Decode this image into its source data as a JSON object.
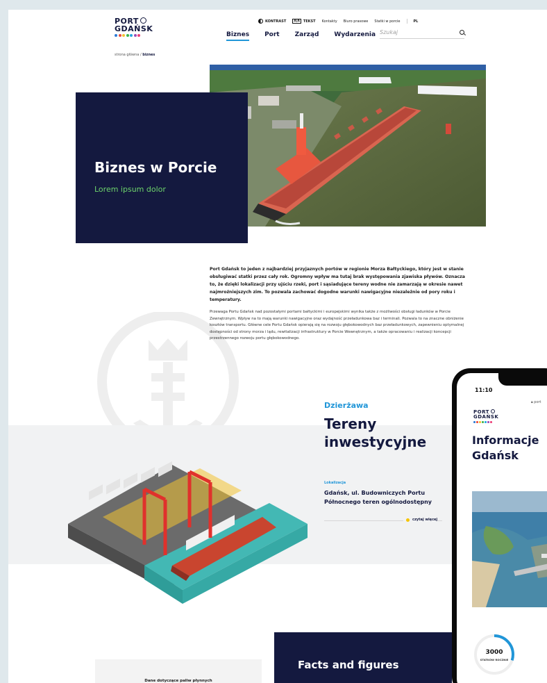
{
  "logo": {
    "line1": "PORT",
    "line2": "GDAŃSK",
    "dots": [
      "#2e7bd6",
      "#e94c3d",
      "#f6c12f",
      "#3cb24b",
      "#25a6e0",
      "#9b4fb8",
      "#ec407a"
    ]
  },
  "topbar": {
    "contrast": "KONTRAST",
    "aa": "A|A",
    "text_size": "TEKST",
    "links": [
      "Kontakty",
      "Biuro prasowe",
      "Statki w porcie"
    ],
    "lang": "PL"
  },
  "nav": {
    "items": [
      "Biznes",
      "Port",
      "Zarząd",
      "Wydarzenia"
    ],
    "active": "Biznes"
  },
  "search": {
    "placeholder": "Szukaj"
  },
  "breadcrumb": {
    "home": "strona główna",
    "sep": "/",
    "current": "biznes"
  },
  "hero": {
    "title": "Biznes w Porcie",
    "subtitle": "Lorem ipsum dolor"
  },
  "intro": {
    "bold": "Port Gdańsk to jeden z najbardziej przyjaznych portów w regionie Morza Bałtyckiego, który jest w stanie obsługiwać statki przez cały rok. Ogromny wpływ ma tutaj brak występowania zjawiska pływów. Oznacza to, że dzięki lokalizacji przy ujściu rzeki, port i sąsiadujące tereny wodne nie zamarzają w okresie nawet najmroźniejszych zim. To pozwala zachować dogodne warunki nawigacyjne niezależnie od pory roku i temperatury.",
    "regular": "Przewaga Portu Gdańsk nad pozostałymi portami bałtyckimi i europejskimi wynika także z możliwości obsługi ładunków w Porcie Zewnętrznym. Wpływ na to mają warunki nawigacyjne oraz wydajność przeładunkowa baz i terminali. Pozwala to na znaczne obniżenie kosztów transportu. Główne cele Portu Gdańsk opierają się na rozwoju głębokowodnych baz przeładunkowych, zapewnieniu optymalnej dostępności od strony morza i lądu, rewitalizacji infrastruktury w Porcie Wewnętrznym, a także opracowaniu i realizacji koncepcji przestrzennego rozwoju portu głębokowodnego."
  },
  "lease": {
    "label": "Dzierżawa",
    "title": "Tereny inwestycyjne",
    "loc_label": "Lokalizacja",
    "loc_text": "Gdańsk, ul. Budowniczych Portu Północnego teren ogólnodostępny",
    "read_more": "czytaj więcej"
  },
  "fuel": {
    "text": "Dane dotyczące paliw płynnych"
  },
  "facts": {
    "title": "Facts and figures"
  },
  "phone": {
    "time": "11:10",
    "url": "port",
    "title": "Informacje Gdańsk",
    "stat_value": "3000",
    "stat_label": "STATKÓW ROCZNIE",
    "stat_progress": 0.3
  },
  "colors": {
    "navy": "#14193f",
    "accent_blue": "#2196d8",
    "accent_green": "#6dd36b",
    "accent_yellow": "#f5c400"
  }
}
